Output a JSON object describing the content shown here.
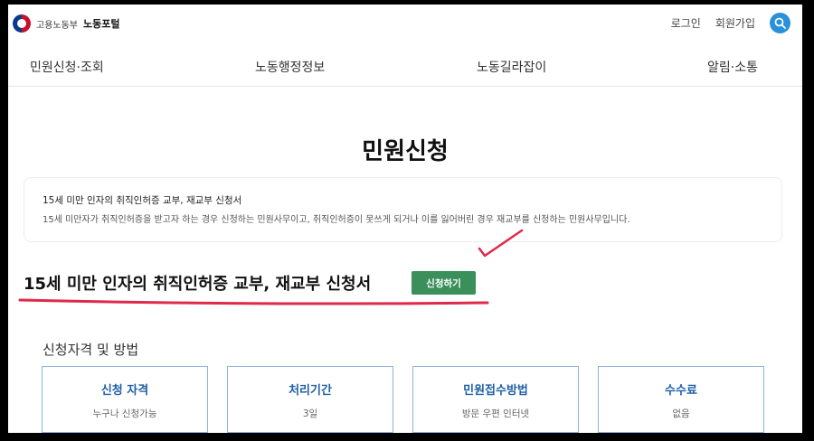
{
  "header": {
    "ministry": "고용노동부",
    "portal": "노동포털",
    "login": "로그인",
    "signup": "회원가입"
  },
  "gnb": {
    "items": [
      {
        "label": "민원신청·조회"
      },
      {
        "label": "노동행정정보"
      },
      {
        "label": "노동길라잡이"
      },
      {
        "label": "알림·소통"
      }
    ]
  },
  "page": {
    "title": "민원신청"
  },
  "summary": {
    "title": "15세 미만 인자의 취직인허증 교부, 재교부 신청서",
    "description": "15세 미만자가 취직인허증을 받고자 하는 경우 신청하는 민원사무이고, 취직인허증이 못쓰게 되거나 이를 잃어버린 경우 재교부를 신청하는 민원사무입니다."
  },
  "form": {
    "title": "15세 미만 인자의 취직인허증 교부, 재교부 신청서",
    "apply_label": "신청하기"
  },
  "section": {
    "title": "신청자격 및 방법",
    "cards": [
      {
        "label": "신청 자격",
        "value": "누구나 신청가능"
      },
      {
        "label": "처리기간",
        "value": "3일"
      },
      {
        "label": "민원접수방법",
        "value": "방문 우편 인터넷"
      },
      {
        "label": "수수료",
        "value": "없음"
      }
    ]
  },
  "colors": {
    "accent": "#2a90d9",
    "apply_button": "#3b8f5a",
    "card_border": "#8db3d9",
    "card_label": "#1f5fa6",
    "annotation": "#e0294a"
  }
}
